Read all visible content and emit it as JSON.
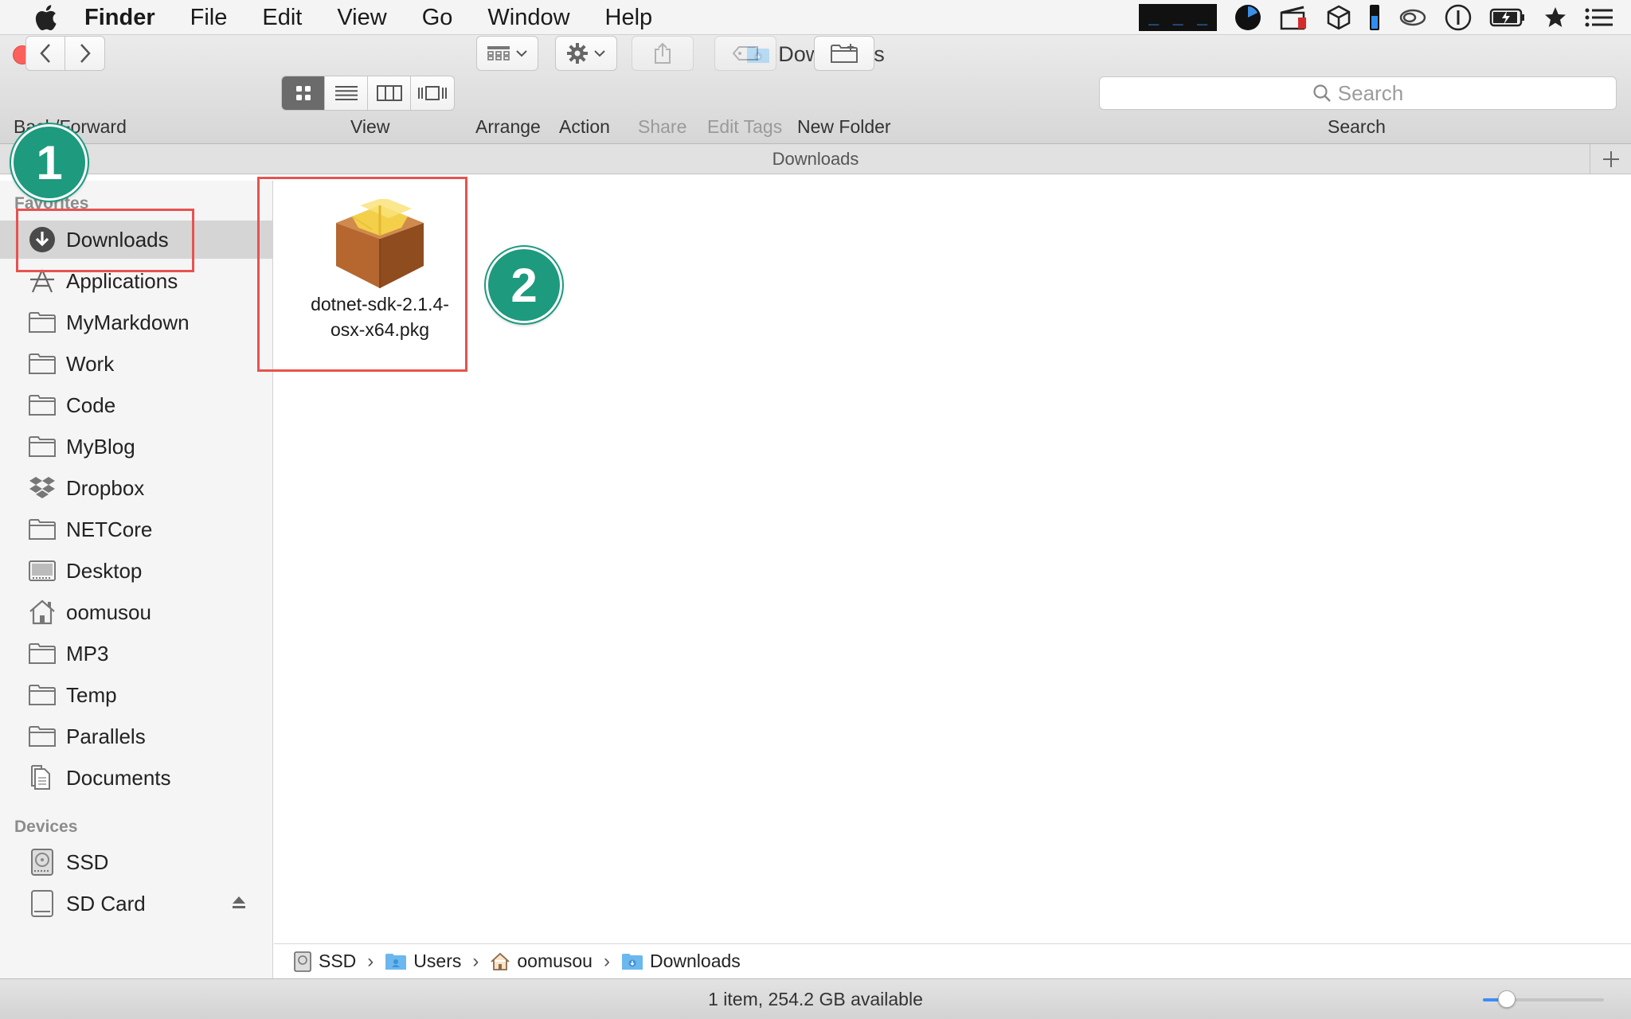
{
  "menubar": {
    "app_name": "Finder",
    "menus": [
      "File",
      "Edit",
      "View",
      "Go",
      "Window",
      "Help"
    ]
  },
  "window": {
    "title": "Downloads",
    "toolbar": {
      "back_forward_label": "Back/Forward",
      "view_label": "View",
      "arrange_label": "Arrange",
      "action_label": "Action",
      "share_label": "Share",
      "edit_tags_label": "Edit Tags",
      "new_folder_label": "New Folder",
      "search_label": "Search",
      "search_placeholder": "Search"
    },
    "path_title": "Downloads"
  },
  "sidebar": {
    "favorites_header": "Favorites",
    "favorites": [
      {
        "label": "Downloads",
        "icon": "download-circle-icon",
        "selected": true
      },
      {
        "label": "Applications",
        "icon": "applications-icon"
      },
      {
        "label": "MyMarkdown",
        "icon": "folder-icon"
      },
      {
        "label": "Work",
        "icon": "folder-icon"
      },
      {
        "label": "Code",
        "icon": "folder-icon"
      },
      {
        "label": "MyBlog",
        "icon": "folder-icon"
      },
      {
        "label": "Dropbox",
        "icon": "dropbox-icon"
      },
      {
        "label": "NETCore",
        "icon": "folder-icon"
      },
      {
        "label": "Desktop",
        "icon": "desktop-icon"
      },
      {
        "label": "oomusou",
        "icon": "home-icon"
      },
      {
        "label": "MP3",
        "icon": "folder-icon"
      },
      {
        "label": "Temp",
        "icon": "folder-icon"
      },
      {
        "label": "Parallels",
        "icon": "folder-icon"
      },
      {
        "label": "Documents",
        "icon": "documents-icon"
      }
    ],
    "devices_header": "Devices",
    "devices": [
      {
        "label": "SSD",
        "icon": "hard-drive-icon"
      },
      {
        "label": "SD Card",
        "icon": "sd-card-icon",
        "ejectable": true
      }
    ]
  },
  "files": [
    {
      "name_line1": "dotnet-sdk-2.1.4-",
      "name_line2": "osx-x64.pkg",
      "icon": "package-icon"
    }
  ],
  "path_bar": {
    "items": [
      "SSD",
      "Users",
      "oomusou",
      "Downloads"
    ],
    "separator": "›"
  },
  "status": {
    "text": "1 item, 254.2 GB available",
    "icon_size_slider": 0.2
  },
  "annotations": {
    "badge_1": "1",
    "badge_2": "2",
    "color": "#e8524f",
    "badge_color": "#1e9a7e"
  }
}
